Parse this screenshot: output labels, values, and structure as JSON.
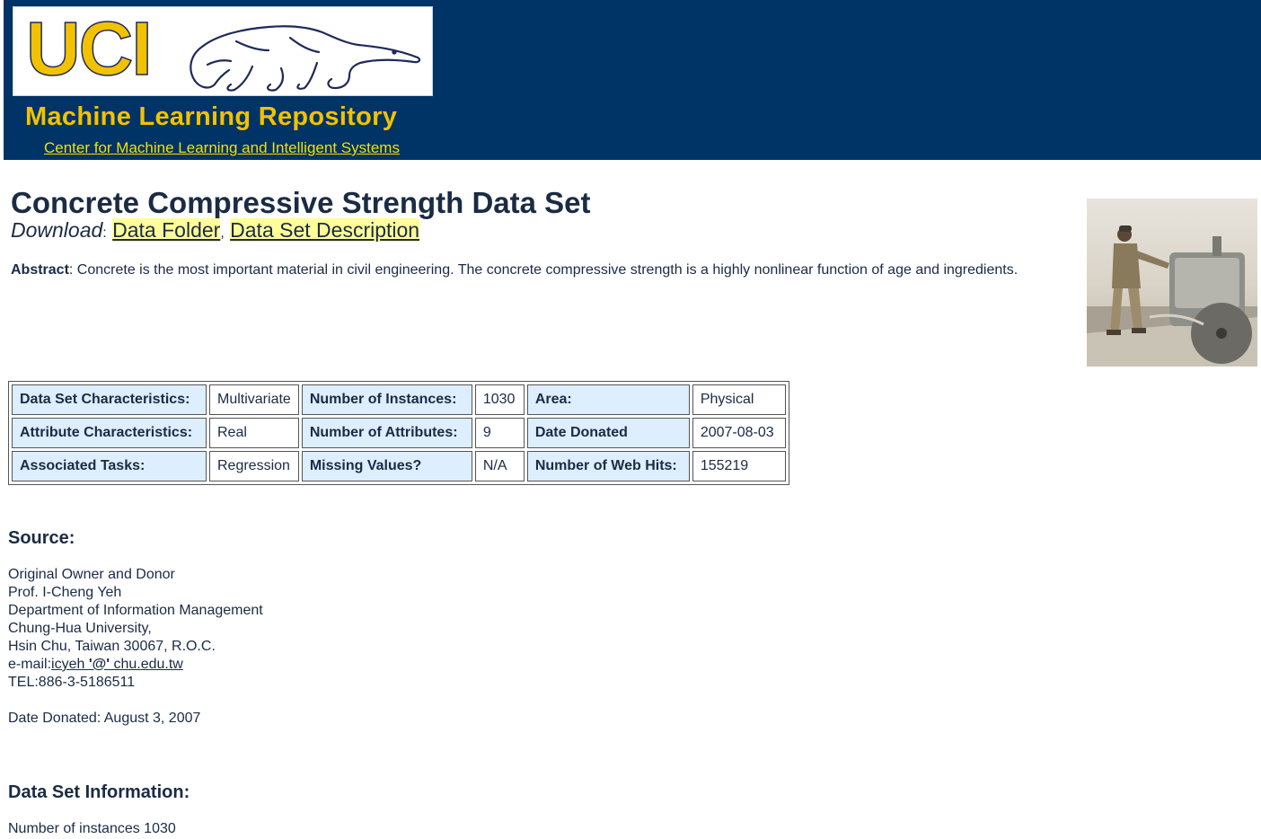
{
  "header": {
    "logo_text": "UCI",
    "repo_title": "Machine Learning Repository",
    "center_link": "Center for Machine Learning and Intelligent Systems",
    "background": "#003366",
    "accent": "#f2c200"
  },
  "dataset": {
    "title": "Concrete Compressive Strength Data Set",
    "download_label": "Download",
    "download_colon": ":",
    "link_separator": ",",
    "links": [
      "Data Folder",
      "Data Set Description"
    ],
    "abstract_label": "Abstract",
    "abstract_text": ": Concrete is the most important material in civil engineering. The concrete compressive strength is a highly nonlinear function of age and ingredients.",
    "photo_icon": "concrete-saw-worker-photo"
  },
  "characteristics": [
    [
      {
        "k": "Data Set Characteristics:",
        "v": "Multivariate"
      },
      {
        "k": "Number of Instances:",
        "v": "1030"
      },
      {
        "k": "Area:",
        "v": "Physical"
      }
    ],
    [
      {
        "k": "Attribute Characteristics:",
        "v": "Real"
      },
      {
        "k": "Number of Attributes:",
        "v": "9"
      },
      {
        "k": "Date Donated",
        "v": "2007-08-03"
      }
    ],
    [
      {
        "k": "Associated Tasks:",
        "v": "Regression"
      },
      {
        "k": "Missing Values?",
        "v": "N/A"
      },
      {
        "k": "Number of Web Hits:",
        "v": "155219"
      }
    ]
  ],
  "source": {
    "heading": "Source:",
    "lines": [
      "Original Owner and Donor",
      "Prof. I-Cheng Yeh",
      "Department of Information Management",
      "Chung-Hua University,",
      "Hsin Chu, Taiwan 30067, R.O.C."
    ],
    "email_prefix": "e-mail:",
    "email_user": "icyeh ",
    "email_at": "'@'",
    "email_domain": " chu.edu.tw",
    "tel": "TEL:886-3-5186511",
    "date_donated": "Date Donated: August 3, 2007"
  },
  "info": {
    "heading": "Data Set Information:",
    "instances": "Number of instances 1030"
  }
}
